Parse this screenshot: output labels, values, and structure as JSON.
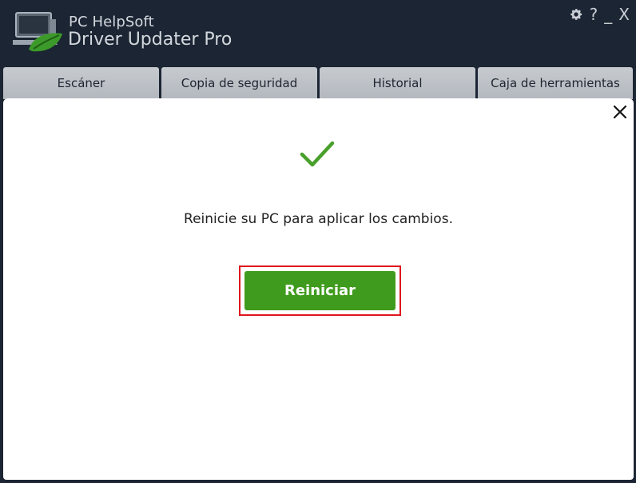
{
  "app": {
    "brand_line1": "PC HelpSoft",
    "brand_line2": "Driver Updater Pro",
    "logo_icon": "laptop-leaf-logo"
  },
  "window_controls": {
    "settings_icon": "gear-icon",
    "help_label": "?",
    "minimize_label": "_",
    "close_label": "X"
  },
  "tabs": [
    {
      "label": "Escáner"
    },
    {
      "label": "Copia de seguridad"
    },
    {
      "label": "Historial"
    },
    {
      "label": "Caja de herramientas"
    }
  ],
  "dialog": {
    "close_icon": "close-icon",
    "status_icon": "checkmark-icon",
    "message": "Reinicie su PC para aplicar los cambios.",
    "restart_label": "Reiniciar"
  },
  "colors": {
    "background": "#1c2533",
    "tab": "#c0c4c9",
    "accent_green": "#3f9b1d",
    "highlight_red": "#e0141e",
    "check_green": "#48a02b"
  }
}
